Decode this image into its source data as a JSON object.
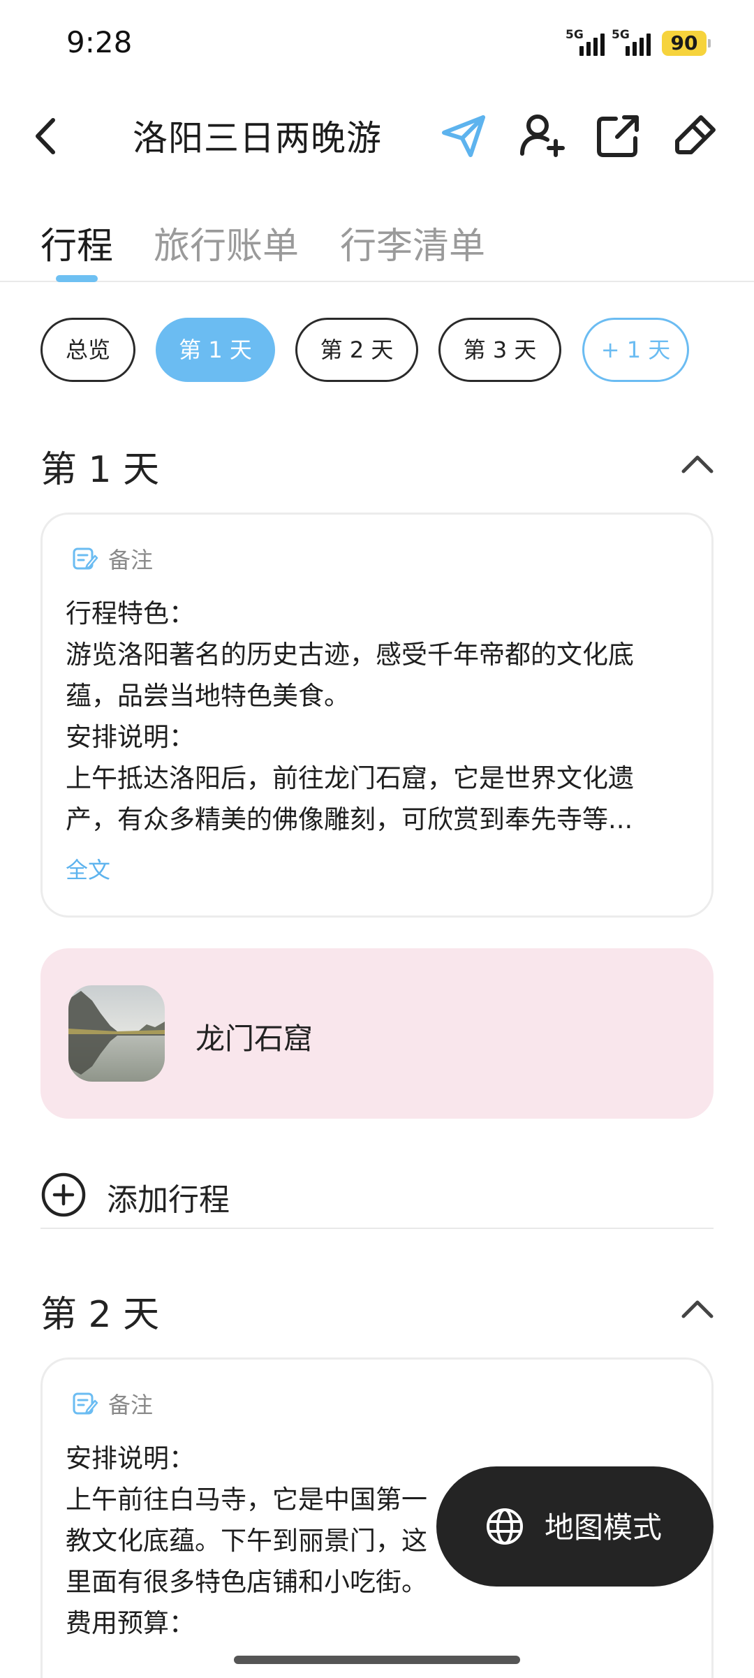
{
  "status": {
    "time": "9:28",
    "net1": "5G",
    "net2": "5G",
    "battery": "90"
  },
  "header": {
    "title": "洛阳三日两晚游",
    "icons": [
      "back-icon",
      "send-icon",
      "add-person-icon",
      "share-icon",
      "edit-icon"
    ],
    "accent": "#5db3ee"
  },
  "tabs": [
    {
      "label": "行程",
      "active": true
    },
    {
      "label": "旅行账单",
      "active": false
    },
    {
      "label": "行李清单",
      "active": false
    }
  ],
  "chips": [
    {
      "label": "总览"
    },
    {
      "label": "第 1 天",
      "active": true
    },
    {
      "label": "第 2 天"
    },
    {
      "label": "第 3 天"
    },
    {
      "label": "+ 1 天"
    }
  ],
  "days": [
    {
      "title": "第 1 天",
      "note_label": "备注",
      "note_lines": [
        "行程特色：",
        "游览洛阳著名的历史古迹，感受千年帝都的文化底",
        "蕴，品尝当地特色美食。",
        "安排说明：",
        "上午抵达洛阳后，前往龙门石窟，它是世界文化遗",
        "产，有众多精美的佛像雕刻，可欣赏到奉先寺等..."
      ],
      "fulltext": "全文",
      "poi": {
        "name": "龙门石窟",
        "color": "#f9e6ec"
      },
      "add_label": "添加行程"
    },
    {
      "title": "第 2 天",
      "note_label": "备注",
      "note_lines": [
        "安排说明：",
        "上午前往白马寺，它是中国第一",
        "教文化底蕴。下午到丽景门，这",
        "里面有很多特色店铺和小吃街。",
        "费用预算："
      ]
    }
  ],
  "fab": {
    "label": "地图模式",
    "icon": "globe-icon"
  }
}
